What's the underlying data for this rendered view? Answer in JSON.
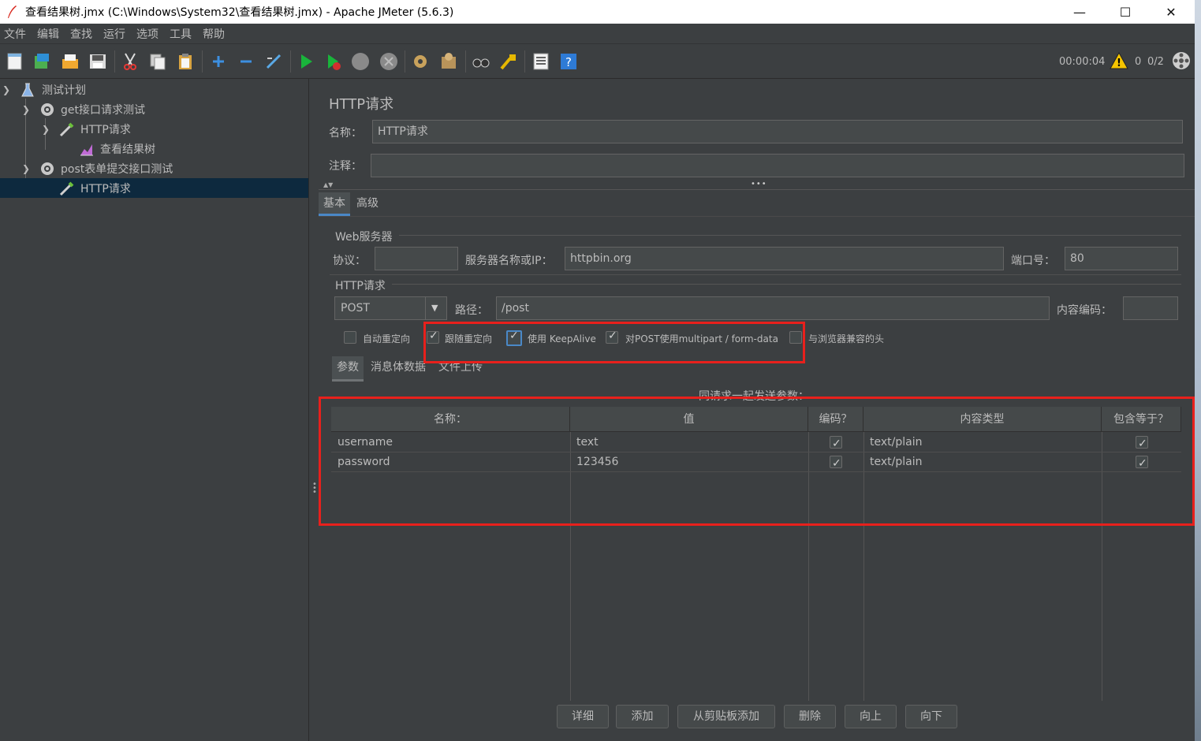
{
  "window": {
    "title": "查看结果树.jmx (C:\\Windows\\System32\\查看结果树.jmx) - Apache JMeter (5.6.3)",
    "minimize": "—",
    "maximize": "☐",
    "close": "✕"
  },
  "menu": [
    "文件",
    "编辑",
    "查找",
    "运行",
    "选项",
    "工具",
    "帮助"
  ],
  "toolbar": {
    "timer": "00:00:04",
    "warning_count": "0",
    "threads": "0/2"
  },
  "tree": {
    "items": [
      {
        "label": "测试计划"
      },
      {
        "label": "get接口请求测试"
      },
      {
        "label": "HTTP请求"
      },
      {
        "label": "查看结果树"
      },
      {
        "label": "post表单提交接口测试"
      },
      {
        "label": "HTTP请求"
      }
    ]
  },
  "editor": {
    "heading": "HTTP请求",
    "name_label": "名称：",
    "name_value": "HTTP请求",
    "comment_label": "注释：",
    "comment_value": "",
    "tabs": [
      "基本",
      "高级"
    ],
    "web_server": {
      "group_title": "Web服务器",
      "protocol_label": "协议：",
      "protocol_value": "",
      "server_label": "服务器名称或IP：",
      "server_value": "httpbin.org",
      "port_label": "端口号：",
      "port_value": "80"
    },
    "http_request": {
      "group_title": "HTTP请求",
      "method": "POST",
      "path_label": "路径：",
      "path_value": "/post",
      "encoding_label": "内容编码：",
      "encoding_value": ""
    },
    "options": [
      {
        "label": "自动重定向",
        "checked": false
      },
      {
        "label": "跟随重定向",
        "checked": true
      },
      {
        "label": "使用 KeepAlive",
        "checked": true
      },
      {
        "label": "对POST使用multipart / form-data",
        "checked": true
      },
      {
        "label": "与浏览器兼容的头",
        "checked": false
      }
    ],
    "subtabs": [
      "参数",
      "消息体数据",
      "文件上传"
    ],
    "params_caption": "同请求一起发送参数：",
    "table": {
      "headers": [
        "名称：",
        "值",
        "编码？",
        "内容类型",
        "包含等于？"
      ],
      "rows": [
        {
          "name": "username",
          "value": "text",
          "encode": true,
          "content_type": "text/plain",
          "include_equals": true
        },
        {
          "name": "password",
          "value": "123456",
          "encode": true,
          "content_type": "text/plain",
          "include_equals": true
        }
      ]
    },
    "buttons": [
      "详细",
      "添加",
      "从剪贴板添加",
      "删除",
      "向上",
      "向下"
    ]
  },
  "colors": {
    "background": "#3c3f41",
    "selection": "#0d293e",
    "annotation": "#e8201c",
    "focus": "#4a88c7"
  }
}
